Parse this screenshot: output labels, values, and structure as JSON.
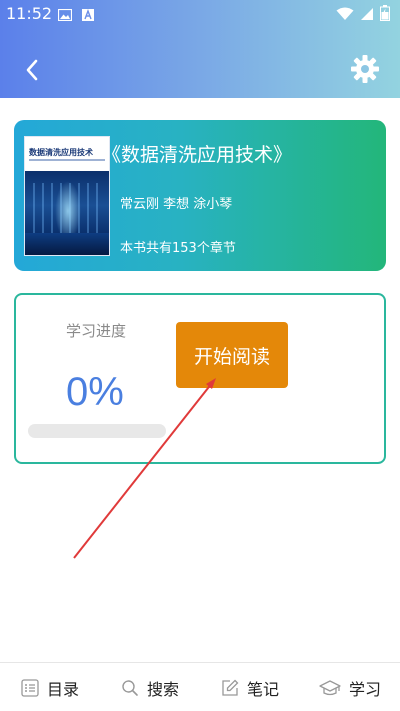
{
  "status_bar": {
    "time": "11:52",
    "left_icons": [
      "image-icon",
      "a-icon"
    ],
    "right_icons": [
      "wifi-icon",
      "signal-icon",
      "battery-icon"
    ]
  },
  "header": {
    "back_icon": "chevron-left-icon",
    "settings_icon": "gear-icon"
  },
  "book": {
    "title": "《数据清洗应用技术》",
    "authors": "常云刚 李想 涂小琴",
    "chapters": "本书共有153个章节",
    "cover_title": "数据清洗应用技术"
  },
  "progress": {
    "label": "学习进度",
    "percent_text": "0%",
    "percent_value": 0,
    "start_button": "开始阅读"
  },
  "bottom_nav": [
    {
      "label": "目录",
      "icon": "list-icon"
    },
    {
      "label": "搜索",
      "icon": "search-icon"
    },
    {
      "label": "笔记",
      "icon": "edit-icon"
    },
    {
      "label": "学习",
      "icon": "graduation-cap-icon"
    }
  ],
  "colors": {
    "accent_blue": "#4a7fe0",
    "button_orange": "#e48809",
    "card_border": "#2ab79d",
    "annotation_red": "#e03a3a"
  }
}
